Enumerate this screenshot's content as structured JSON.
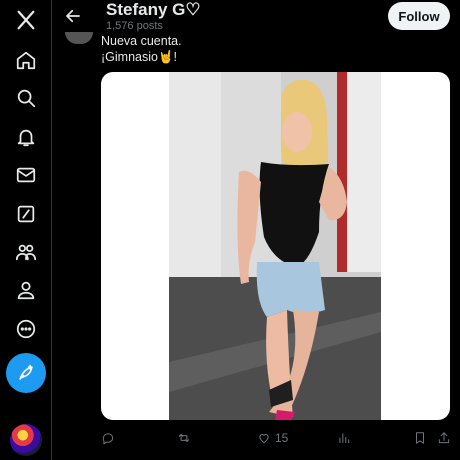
{
  "header": {
    "profile_name": "Stefany G♡",
    "post_count": "1,576 posts",
    "follow_label": "Follow"
  },
  "tweet": {
    "line1": "Nueva cuenta.",
    "line2": "¡Gimnasio🤘!",
    "likes": "15"
  },
  "icons": {
    "logo": "x-logo-icon",
    "nav": [
      "home-icon",
      "search-icon",
      "notifications-icon",
      "messages-icon",
      "grok-icon",
      "communities-icon",
      "profile-icon",
      "more-icon"
    ],
    "compose": "compose-icon",
    "back": "back-arrow-icon",
    "actions": [
      "reply-icon",
      "retweet-icon",
      "like-icon",
      "views-icon",
      "bookmark-icon",
      "share-icon"
    ]
  },
  "colors": {
    "accent": "#1d9bf0",
    "background": "#000000",
    "text": "#e7e9ea",
    "muted": "#71767b"
  }
}
